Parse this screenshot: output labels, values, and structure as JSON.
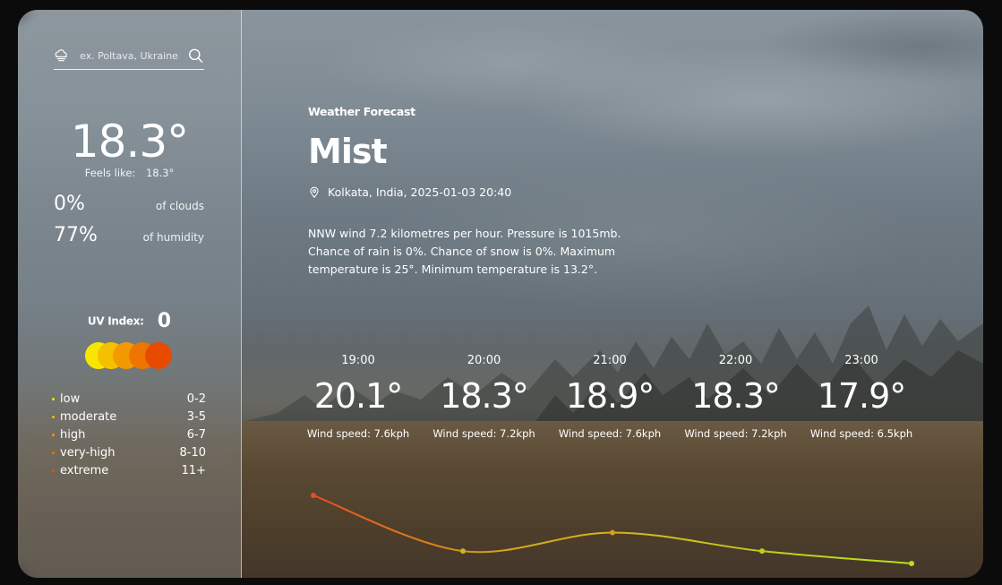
{
  "search": {
    "placeholder": "ex. Poltava, Ukraine"
  },
  "current": {
    "temp": "18.3°",
    "feels_label": "Feels like:",
    "feels_value": "18.3°",
    "clouds_value": "0%",
    "clouds_label": "of clouds",
    "humidity_value": "77%",
    "humidity_label": "of humidity"
  },
  "uv": {
    "label": "UV Index:",
    "value": "0",
    "dot_colors": [
      "#f7e600",
      "#f5c000",
      "#f39a00",
      "#f07400",
      "#e84a00"
    ],
    "levels": [
      {
        "name": "low",
        "range": "0-2",
        "color": "#f7e600"
      },
      {
        "name": "moderate",
        "range": "3-5",
        "color": "#f5c000"
      },
      {
        "name": "high",
        "range": "6-7",
        "color": "#f39a00"
      },
      {
        "name": "very-high",
        "range": "8-10",
        "color": "#f07400"
      },
      {
        "name": "extreme",
        "range": "11+",
        "color": "#e84a00"
      }
    ]
  },
  "forecast": {
    "eyebrow": "Weather Forecast",
    "condition": "Mist",
    "location": "Kolkata, India, 2025-01-03 20:40",
    "description": "NNW wind 7.2 kilometres per hour. Pressure is 1015mb. Chance of rain is 0%. Chance of snow is 0%. Maximum temperature is 25°. Minimum temperature is 13.2°."
  },
  "hourly": [
    {
      "time": "19:00",
      "temp": "20.1°",
      "wind": "Wind speed: 7.6kph"
    },
    {
      "time": "20:00",
      "temp": "18.3°",
      "wind": "Wind speed: 7.2kph"
    },
    {
      "time": "21:00",
      "temp": "18.9°",
      "wind": "Wind speed: 7.6kph"
    },
    {
      "time": "22:00",
      "temp": "18.3°",
      "wind": "Wind speed: 7.2kph"
    },
    {
      "time": "23:00",
      "temp": "17.9°",
      "wind": "Wind speed: 6.5kph"
    }
  ],
  "colors": {
    "curve_start": "#e8501c",
    "curve_end": "#b6e21c"
  }
}
